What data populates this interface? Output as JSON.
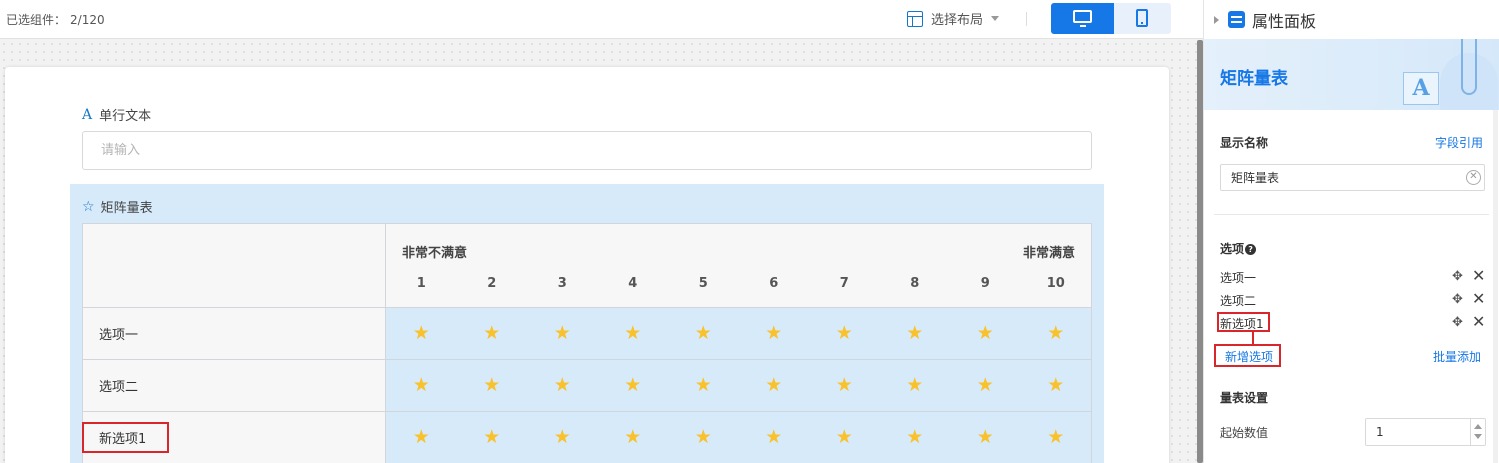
{
  "topbar": {
    "selected_label": "已选组件：",
    "selected_count": "2/120",
    "layout_label": "选择布局"
  },
  "form": {
    "text_field": {
      "label": "单行文本",
      "placeholder": "请输入"
    },
    "matrix": {
      "label": "矩阵量表",
      "scale_low": "非常不满意",
      "scale_high": "非常满意",
      "scale_numbers": [
        "1",
        "2",
        "3",
        "4",
        "5",
        "6",
        "7",
        "8",
        "9",
        "10"
      ],
      "rows": [
        "选项一",
        "选项二",
        "新选项1"
      ],
      "icon_color": "#f9c12c"
    }
  },
  "panel": {
    "title": "属性面板",
    "banner_title": "矩阵量表",
    "display_name_label": "显示名称",
    "field_ref_link": "字段引用",
    "display_name_value": "矩阵量表",
    "options_label": "选项",
    "options": [
      "选项一",
      "选项二",
      "新选项1"
    ],
    "add_option": "新增选项",
    "batch_add": "批量添加",
    "scale_settings_label": "量表设置",
    "start_value_label": "起始数值",
    "start_value": "1"
  },
  "colors": {
    "accent": "#1677e6",
    "highlight_border": "#d9262b",
    "matrix_bg": "#d6eafa"
  }
}
